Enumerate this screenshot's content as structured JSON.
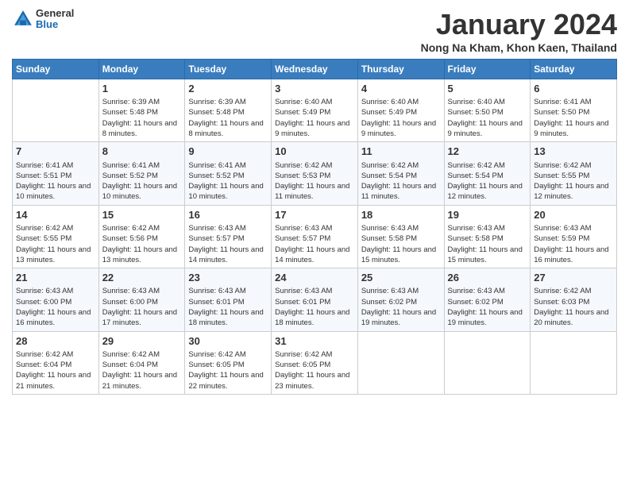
{
  "header": {
    "logo_general": "General",
    "logo_blue": "Blue",
    "month_title": "January 2024",
    "location": "Nong Na Kham, Khon Kaen, Thailand"
  },
  "days_of_week": [
    "Sunday",
    "Monday",
    "Tuesday",
    "Wednesday",
    "Thursday",
    "Friday",
    "Saturday"
  ],
  "weeks": [
    [
      {
        "day": "",
        "sunrise": "",
        "sunset": "",
        "daylight": ""
      },
      {
        "day": "1",
        "sunrise": "Sunrise: 6:39 AM",
        "sunset": "Sunset: 5:48 PM",
        "daylight": "Daylight: 11 hours and 8 minutes."
      },
      {
        "day": "2",
        "sunrise": "Sunrise: 6:39 AM",
        "sunset": "Sunset: 5:48 PM",
        "daylight": "Daylight: 11 hours and 8 minutes."
      },
      {
        "day": "3",
        "sunrise": "Sunrise: 6:40 AM",
        "sunset": "Sunset: 5:49 PM",
        "daylight": "Daylight: 11 hours and 9 minutes."
      },
      {
        "day": "4",
        "sunrise": "Sunrise: 6:40 AM",
        "sunset": "Sunset: 5:49 PM",
        "daylight": "Daylight: 11 hours and 9 minutes."
      },
      {
        "day": "5",
        "sunrise": "Sunrise: 6:40 AM",
        "sunset": "Sunset: 5:50 PM",
        "daylight": "Daylight: 11 hours and 9 minutes."
      },
      {
        "day": "6",
        "sunrise": "Sunrise: 6:41 AM",
        "sunset": "Sunset: 5:50 PM",
        "daylight": "Daylight: 11 hours and 9 minutes."
      }
    ],
    [
      {
        "day": "7",
        "sunrise": "Sunrise: 6:41 AM",
        "sunset": "Sunset: 5:51 PM",
        "daylight": "Daylight: 11 hours and 10 minutes."
      },
      {
        "day": "8",
        "sunrise": "Sunrise: 6:41 AM",
        "sunset": "Sunset: 5:52 PM",
        "daylight": "Daylight: 11 hours and 10 minutes."
      },
      {
        "day": "9",
        "sunrise": "Sunrise: 6:41 AM",
        "sunset": "Sunset: 5:52 PM",
        "daylight": "Daylight: 11 hours and 10 minutes."
      },
      {
        "day": "10",
        "sunrise": "Sunrise: 6:42 AM",
        "sunset": "Sunset: 5:53 PM",
        "daylight": "Daylight: 11 hours and 11 minutes."
      },
      {
        "day": "11",
        "sunrise": "Sunrise: 6:42 AM",
        "sunset": "Sunset: 5:54 PM",
        "daylight": "Daylight: 11 hours and 11 minutes."
      },
      {
        "day": "12",
        "sunrise": "Sunrise: 6:42 AM",
        "sunset": "Sunset: 5:54 PM",
        "daylight": "Daylight: 11 hours and 12 minutes."
      },
      {
        "day": "13",
        "sunrise": "Sunrise: 6:42 AM",
        "sunset": "Sunset: 5:55 PM",
        "daylight": "Daylight: 11 hours and 12 minutes."
      }
    ],
    [
      {
        "day": "14",
        "sunrise": "Sunrise: 6:42 AM",
        "sunset": "Sunset: 5:55 PM",
        "daylight": "Daylight: 11 hours and 13 minutes."
      },
      {
        "day": "15",
        "sunrise": "Sunrise: 6:42 AM",
        "sunset": "Sunset: 5:56 PM",
        "daylight": "Daylight: 11 hours and 13 minutes."
      },
      {
        "day": "16",
        "sunrise": "Sunrise: 6:43 AM",
        "sunset": "Sunset: 5:57 PM",
        "daylight": "Daylight: 11 hours and 14 minutes."
      },
      {
        "day": "17",
        "sunrise": "Sunrise: 6:43 AM",
        "sunset": "Sunset: 5:57 PM",
        "daylight": "Daylight: 11 hours and 14 minutes."
      },
      {
        "day": "18",
        "sunrise": "Sunrise: 6:43 AM",
        "sunset": "Sunset: 5:58 PM",
        "daylight": "Daylight: 11 hours and 15 minutes."
      },
      {
        "day": "19",
        "sunrise": "Sunrise: 6:43 AM",
        "sunset": "Sunset: 5:58 PM",
        "daylight": "Daylight: 11 hours and 15 minutes."
      },
      {
        "day": "20",
        "sunrise": "Sunrise: 6:43 AM",
        "sunset": "Sunset: 5:59 PM",
        "daylight": "Daylight: 11 hours and 16 minutes."
      }
    ],
    [
      {
        "day": "21",
        "sunrise": "Sunrise: 6:43 AM",
        "sunset": "Sunset: 6:00 PM",
        "daylight": "Daylight: 11 hours and 16 minutes."
      },
      {
        "day": "22",
        "sunrise": "Sunrise: 6:43 AM",
        "sunset": "Sunset: 6:00 PM",
        "daylight": "Daylight: 11 hours and 17 minutes."
      },
      {
        "day": "23",
        "sunrise": "Sunrise: 6:43 AM",
        "sunset": "Sunset: 6:01 PM",
        "daylight": "Daylight: 11 hours and 18 minutes."
      },
      {
        "day": "24",
        "sunrise": "Sunrise: 6:43 AM",
        "sunset": "Sunset: 6:01 PM",
        "daylight": "Daylight: 11 hours and 18 minutes."
      },
      {
        "day": "25",
        "sunrise": "Sunrise: 6:43 AM",
        "sunset": "Sunset: 6:02 PM",
        "daylight": "Daylight: 11 hours and 19 minutes."
      },
      {
        "day": "26",
        "sunrise": "Sunrise: 6:43 AM",
        "sunset": "Sunset: 6:02 PM",
        "daylight": "Daylight: 11 hours and 19 minutes."
      },
      {
        "day": "27",
        "sunrise": "Sunrise: 6:42 AM",
        "sunset": "Sunset: 6:03 PM",
        "daylight": "Daylight: 11 hours and 20 minutes."
      }
    ],
    [
      {
        "day": "28",
        "sunrise": "Sunrise: 6:42 AM",
        "sunset": "Sunset: 6:04 PM",
        "daylight": "Daylight: 11 hours and 21 minutes."
      },
      {
        "day": "29",
        "sunrise": "Sunrise: 6:42 AM",
        "sunset": "Sunset: 6:04 PM",
        "daylight": "Daylight: 11 hours and 21 minutes."
      },
      {
        "day": "30",
        "sunrise": "Sunrise: 6:42 AM",
        "sunset": "Sunset: 6:05 PM",
        "daylight": "Daylight: 11 hours and 22 minutes."
      },
      {
        "day": "31",
        "sunrise": "Sunrise: 6:42 AM",
        "sunset": "Sunset: 6:05 PM",
        "daylight": "Daylight: 11 hours and 23 minutes."
      },
      {
        "day": "",
        "sunrise": "",
        "sunset": "",
        "daylight": ""
      },
      {
        "day": "",
        "sunrise": "",
        "sunset": "",
        "daylight": ""
      },
      {
        "day": "",
        "sunrise": "",
        "sunset": "",
        "daylight": ""
      }
    ]
  ]
}
